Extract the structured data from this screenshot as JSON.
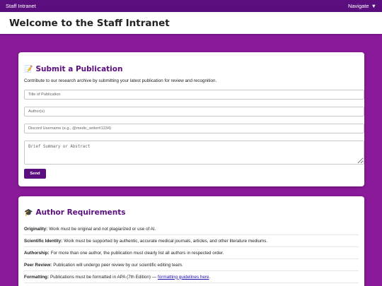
{
  "topbar": {
    "brand": "Staff Intranet",
    "nav_label": "Navigate",
    "nav_caret": "▼"
  },
  "header": {
    "title": "Welcome to the Staff Intranet"
  },
  "publication": {
    "emoji": "📝",
    "title": "Submit a Publication",
    "intro": "Contribute to our research archive by submitting your latest publication for review and recognition.",
    "fields": {
      "title_placeholder": "Title of Publication",
      "authors_placeholder": "Author(s)",
      "discord_placeholder": "Discord Username (e.g., @medic_writer#1234)",
      "summary_placeholder": "Brief Summary or Abstract"
    },
    "send_label": "Send"
  },
  "requirements": {
    "emoji": "🎓",
    "title": "Author Requirements",
    "items": [
      {
        "label": "Originality:",
        "text": "Work must be original and not plagiarized or use of AI."
      },
      {
        "label": "Scientific Identity:",
        "text": "Work must be supported by authentic, accurate medical journals, articles, and other literature mediums."
      },
      {
        "label": "Authorship:",
        "text": "For more than one author, the publication must clearly list all authors in respected order."
      },
      {
        "label": "Peer Review:",
        "text": "Publication will undergo peer review by our scientific editing team."
      },
      {
        "label": "Formatting:",
        "text": "Publications must be formatted in APA (7th Edition) —",
        "link": "formatting guidelines here",
        "after": "."
      }
    ]
  }
}
